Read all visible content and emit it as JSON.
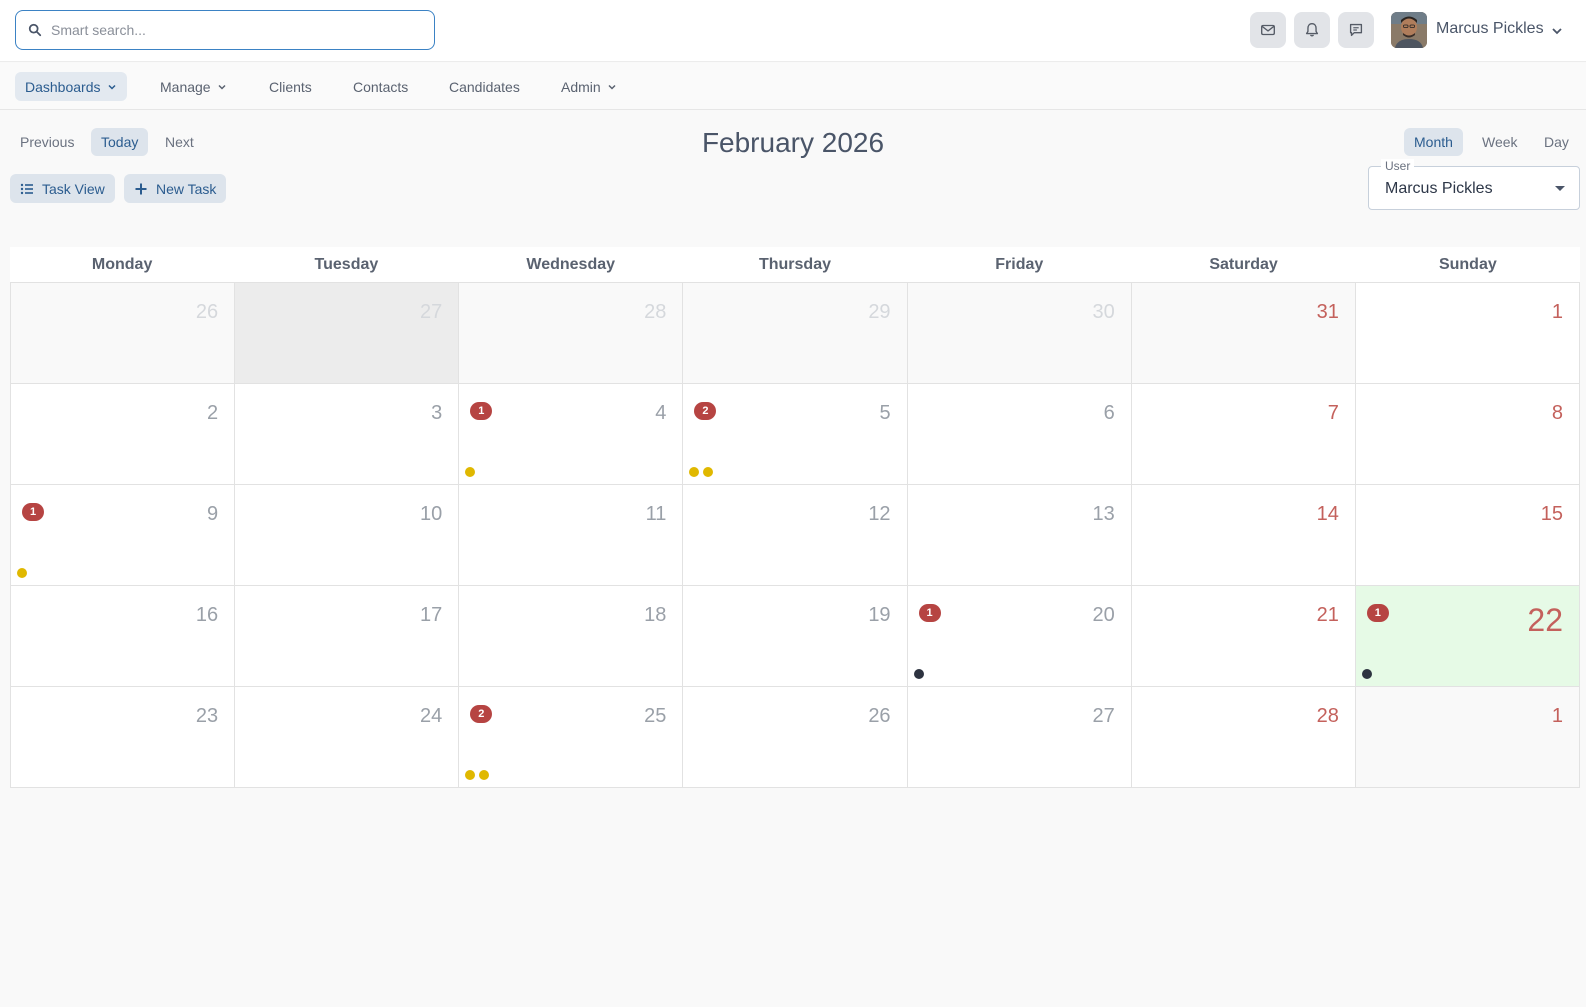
{
  "search": {
    "placeholder": "Smart search..."
  },
  "header": {
    "user_name": "Marcus Pickles"
  },
  "nav": {
    "items": [
      {
        "label": "Dashboards",
        "dropdown": true,
        "active": true
      },
      {
        "label": "Manage",
        "dropdown": true,
        "active": false
      },
      {
        "label": "Clients",
        "dropdown": false,
        "active": false
      },
      {
        "label": "Contacts",
        "dropdown": false,
        "active": false
      },
      {
        "label": "Candidates",
        "dropdown": false,
        "active": false
      },
      {
        "label": "Admin",
        "dropdown": true,
        "active": false
      }
    ]
  },
  "toolbar": {
    "previous": "Previous",
    "today": "Today",
    "next": "Next",
    "title": "February 2026",
    "task_view": "Task View",
    "new_task": "New Task",
    "month": "Month",
    "week": "Week",
    "day": "Day",
    "active_view": "Month"
  },
  "user_filter": {
    "label": "User",
    "value": "Marcus Pickles"
  },
  "calendar": {
    "weekdays": [
      "Monday",
      "Tuesday",
      "Wednesday",
      "Thursday",
      "Friday",
      "Saturday",
      "Sunday"
    ],
    "colors": {
      "badge": "#b64442",
      "dot_yellow": "#e0b800",
      "dot_dark": "#2d3340",
      "today_bg": "#e6fae6"
    },
    "days": [
      {
        "num": "26",
        "other": true
      },
      {
        "num": "27",
        "other": true,
        "highlight": true
      },
      {
        "num": "28",
        "other": true
      },
      {
        "num": "29",
        "other": true
      },
      {
        "num": "30",
        "other": true
      },
      {
        "num": "31",
        "other": true
      },
      {
        "num": "1"
      },
      {
        "num": "2"
      },
      {
        "num": "3"
      },
      {
        "num": "4",
        "badge": "1",
        "dots": [
          "yellow"
        ]
      },
      {
        "num": "5",
        "badge": "2",
        "dots": [
          "yellow",
          "yellow"
        ]
      },
      {
        "num": "6"
      },
      {
        "num": "7"
      },
      {
        "num": "8"
      },
      {
        "num": "9",
        "badge": "1",
        "dots": [
          "yellow"
        ]
      },
      {
        "num": "10"
      },
      {
        "num": "11"
      },
      {
        "num": "12"
      },
      {
        "num": "13"
      },
      {
        "num": "14"
      },
      {
        "num": "15"
      },
      {
        "num": "16"
      },
      {
        "num": "17"
      },
      {
        "num": "18"
      },
      {
        "num": "19"
      },
      {
        "num": "20",
        "badge": "1",
        "dots": [
          "dark"
        ]
      },
      {
        "num": "21"
      },
      {
        "num": "22",
        "badge": "1",
        "dots": [
          "dark"
        ],
        "today": true
      },
      {
        "num": "23"
      },
      {
        "num": "24"
      },
      {
        "num": "25",
        "badge": "2",
        "dots": [
          "yellow",
          "yellow"
        ]
      },
      {
        "num": "26"
      },
      {
        "num": "27"
      },
      {
        "num": "28"
      },
      {
        "num": "1",
        "other": true
      }
    ]
  }
}
